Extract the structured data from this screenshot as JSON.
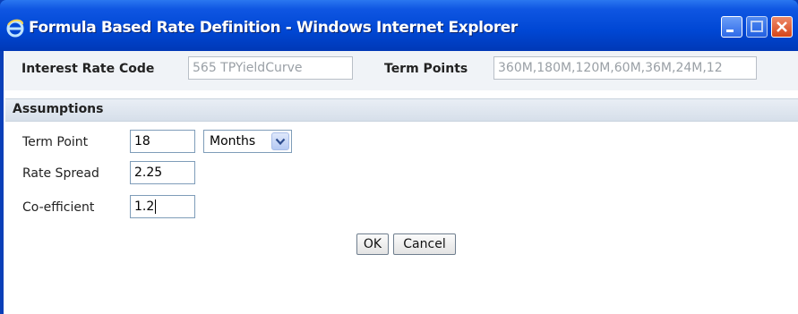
{
  "window": {
    "title": "Formula Based Rate Definition - Windows Internet Explorer"
  },
  "header": {
    "interest_rate_code_label": "Interest Rate Code",
    "interest_rate_code_value": "565 TPYieldCurve",
    "term_points_label": "Term Points",
    "term_points_value": "360M,180M,120M,60M,36M,24M,12"
  },
  "assumptions": {
    "title": "Assumptions",
    "term_point_label": "Term Point",
    "term_point_value": "18",
    "term_unit_selected": "Months",
    "rate_spread_label": "Rate Spread",
    "rate_spread_value": "2.25",
    "coefficient_label": "Co-efficient",
    "coefficient_value": "1.2"
  },
  "buttons": {
    "ok_label": "OK",
    "cancel_label": "Cancel"
  },
  "colors": {
    "titlebar": "#0047d4",
    "close_button": "#d64518"
  },
  "icons": [
    "ie-icon",
    "minimize-icon",
    "maximize-icon",
    "close-icon",
    "chevron-down-icon"
  ]
}
